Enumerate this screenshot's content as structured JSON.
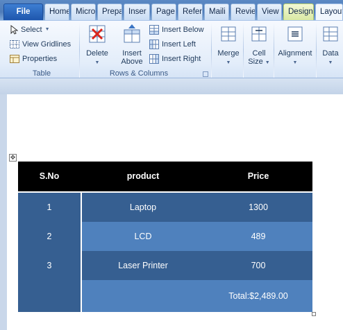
{
  "tabs": [
    {
      "label": "File"
    },
    {
      "label": "Home"
    },
    {
      "label": "Micro"
    },
    {
      "label": "Prepa"
    },
    {
      "label": "Inser"
    },
    {
      "label": "Page"
    },
    {
      "label": "Refer"
    },
    {
      "label": "Maili"
    },
    {
      "label": "Revie"
    },
    {
      "label": "View"
    },
    {
      "label": "Design"
    },
    {
      "label": "Layout"
    }
  ],
  "ribbon": {
    "table_group": {
      "label": "Table",
      "select": "Select",
      "view_gridlines": "View Gridlines",
      "properties": "Properties"
    },
    "rows_columns_group": {
      "label": "Rows & Columns",
      "delete": "Delete",
      "insert_above_1": "Insert",
      "insert_above_2": "Above",
      "insert_below": "Insert Below",
      "insert_left": "Insert Left",
      "insert_right": "Insert Right"
    },
    "merge": "Merge",
    "cell_size_1": "Cell",
    "cell_size_2": "Size",
    "alignment": "Alignment",
    "data": "Data"
  },
  "table": {
    "headers": [
      "S.No",
      "product",
      "Price"
    ],
    "rows": [
      {
        "sno": "1",
        "product": "Laptop",
        "price": "1300"
      },
      {
        "sno": "2",
        "product": "LCD",
        "price": "489"
      },
      {
        "sno": "3",
        "product": "Laser Printer",
        "price": "700"
      }
    ],
    "total": "Total:$2,489.00"
  },
  "colors": {
    "header_bg": "#000000",
    "dark_row": "#365f91",
    "light_row": "#4f81bd"
  }
}
